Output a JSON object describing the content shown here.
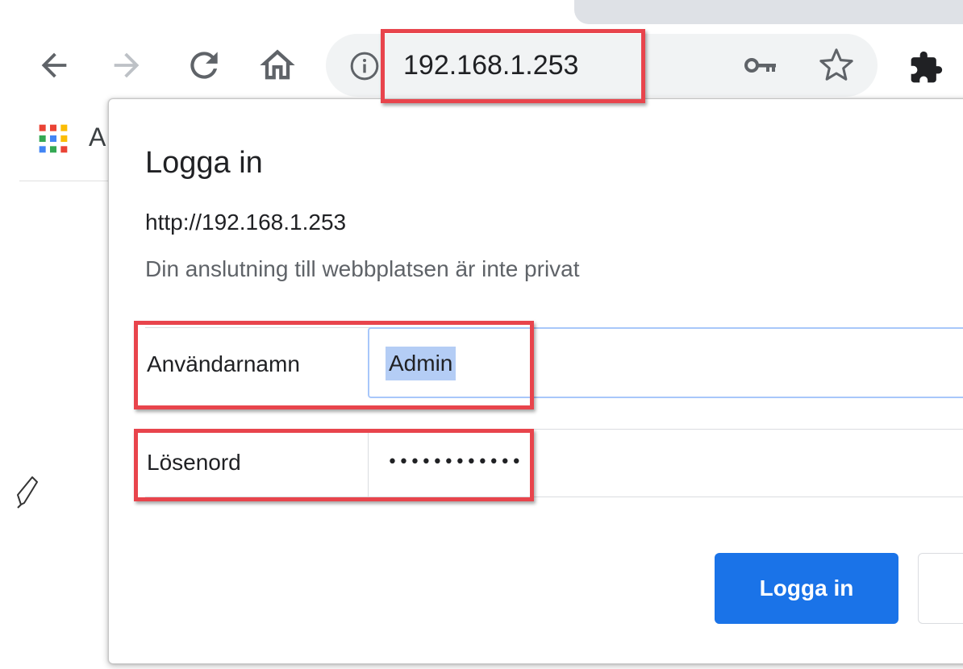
{
  "toolbar": {
    "url": "192.168.1.253"
  },
  "bookmarks": {
    "apps_text": "A"
  },
  "dialog": {
    "title": "Logga in",
    "origin": "http://192.168.1.253",
    "warning": "Din anslutning till webbplatsen är inte privat",
    "username_label": "Användarnamn",
    "username_value": "Admin",
    "password_label": "Lösenord",
    "password_value": "••••••••••••",
    "login_button": "Logga in"
  },
  "colors": {
    "accent": "#1a73e8",
    "annotation": "#e8444c",
    "selection": "#b4cdf5"
  },
  "icons": [
    "back-icon",
    "forward-icon",
    "reload-icon",
    "home-icon",
    "info-icon",
    "key-icon",
    "star-icon",
    "extensions-icon",
    "apps-icon"
  ]
}
